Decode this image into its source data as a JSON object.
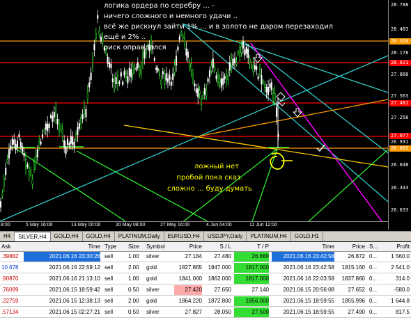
{
  "chart": {
    "annotation_main": [
      "логика ордера по серебру ... -",
      "ничего сложного и немного удачи ..",
      "всё же рискнул      зайти 1% ... и в золото не даром перезаходил",
      "ещё и 2% ..",
      "риск оправдался"
    ],
    "annotation_yellow": [
      "ложный нет",
      "пробой пока сказ.",
      "сложно ... буду думать"
    ],
    "price_labels": [
      "28.788",
      "28.483",
      "28.178",
      "27.868",
      "27.563",
      "27.258",
      "26.931",
      "26.648",
      "26.343",
      "26.033"
    ],
    "marked_prices": [
      {
        "label": "28.324",
        "color": "#ff9900"
      },
      {
        "label": "28.021",
        "color": "#ff0000"
      },
      {
        "label": "27.481",
        "color": "#ff0000"
      },
      {
        "label": "27.077",
        "color": "#ff0000"
      },
      {
        "label": "26.882",
        "color": "#ff9900"
      }
    ],
    "time_labels": [
      "8:00",
      "5 May 16:00",
      "13 May 00:00",
      "20 May 08:00",
      "27 May 16:00",
      "4 Jun 04:00",
      "11 Jun 12:00"
    ]
  },
  "tabs": [
    "H4",
    "SILVER,H4",
    "GOLD,H4",
    "GOLD,H4",
    "PLATINUM,Daily",
    "EURUSD,H4",
    "USDJPY,Daily",
    "PLATINUM,H4",
    "GOLD,H1"
  ],
  "active_tab": 1,
  "table": {
    "left_header": "Ask",
    "left_values": [
      ".39882",
      "10.678",
      ".90870",
      ".76099",
      ".22759",
      ".57134"
    ],
    "headers": [
      "Time",
      "Type",
      "Size",
      "Symbol",
      "Price",
      "S / L",
      "T / P",
      "Time",
      "Price",
      "S...",
      "Profit"
    ],
    "rows": [
      [
        "2021.06.16 23:30:28",
        "sell",
        "1.00",
        "silver",
        "27.184",
        "27.480",
        "26.880",
        "2021.06.16 23:42:58",
        "26.872",
        "0...",
        "1 560.0"
      ],
      [
        "2021.06.16 22:59:12",
        "sell",
        "2.00",
        "gold",
        "1827.865",
        "1847.000",
        "1817.000",
        "2021.06.16 23:42:58",
        "1815.160",
        "0...",
        "2 541.0"
      ],
      [
        "2021.06.16 21:13:10",
        "sell",
        "1.00",
        "gold",
        "1841.000",
        "1862.000",
        "1817.000",
        "2021.06.16 22:03:58",
        "1837.860",
        "0...",
        "314.0"
      ],
      [
        "2021.06.15 18:59:42",
        "sell",
        "0.50",
        "silver",
        "27.420",
        "27.650",
        "27.140",
        "2021.06.15 20:56:08",
        "27.652",
        "0...",
        "-580.0"
      ],
      [
        "2021.06.15 12:38:13",
        "sell",
        "2.00",
        "gold",
        "1864.220",
        "1872.800",
        "1856.000",
        "2021.06.15 18:59:55",
        "1855.996",
        "0...",
        "1 644.8"
      ],
      [
        "2021.06.15 02:27:21",
        "sell",
        "0.50",
        "silver",
        "27.827",
        "28.050",
        "27.500",
        "2021.06.15 18:59:55",
        "27.490",
        "0...",
        "817.5"
      ]
    ],
    "tp_highlight": [
      true,
      true,
      true,
      false,
      true,
      true
    ],
    "sl_highlight": [
      false,
      false,
      false,
      true,
      false,
      false
    ],
    "colors": {
      "tp": "#33dd33",
      "sl": "#ffaaaa",
      "left_red": "#cc0000",
      "left_blue": "#0033cc"
    }
  }
}
